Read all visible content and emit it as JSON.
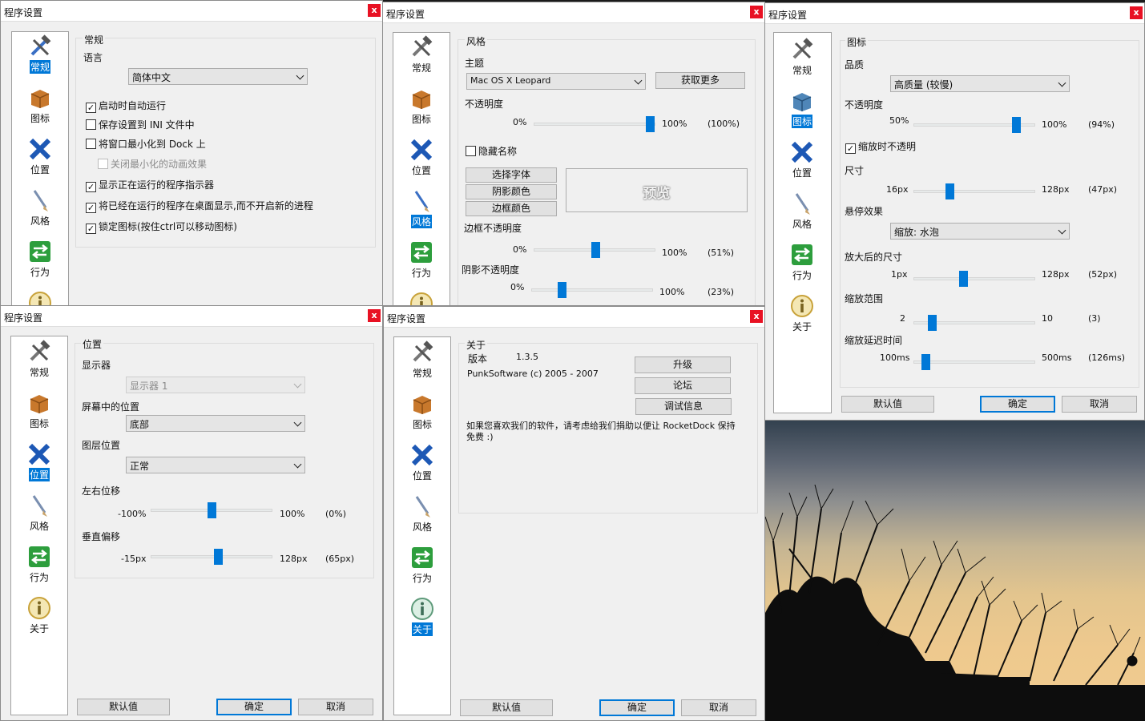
{
  "window_title": "程序设置",
  "close_glyph": "x",
  "nav": {
    "general": "常规",
    "icons": "图标",
    "position": "位置",
    "style": "风格",
    "behavior": "行为",
    "about": "关于"
  },
  "buttons": {
    "defaults": "默认值",
    "ok": "确定",
    "cancel": "取消"
  },
  "general": {
    "title": "常规",
    "language_label": "语言",
    "language_value": "简体中文",
    "options": [
      {
        "label": "启动时自动运行",
        "checked": true,
        "enabled": true
      },
      {
        "label": "保存设置到 INI 文件中",
        "checked": false,
        "enabled": true
      },
      {
        "label": "将窗口最小化到 Dock 上",
        "checked": false,
        "enabled": true
      },
      {
        "label": "关闭最小化的动画效果",
        "checked": false,
        "enabled": false
      },
      {
        "label": "显示正在运行的程序指示器",
        "checked": true,
        "enabled": true
      },
      {
        "label": "将已经在运行的程序在桌面显示,而不开启新的进程",
        "checked": true,
        "enabled": true
      },
      {
        "label": "锁定图标(按住ctrl可以移动图标)",
        "checked": true,
        "enabled": true
      }
    ]
  },
  "style": {
    "title": "风格",
    "theme_label": "主题",
    "theme_value": "Mac OS X Leopard",
    "get_more": "获取更多",
    "opacity": {
      "label": "不透明度",
      "min": "0%",
      "max": "100%",
      "value": "(100%)",
      "level": 1.0
    },
    "hide_labels": {
      "label": "隐藏名称",
      "checked": false
    },
    "font_button": "选择字体",
    "shadow_button": "阴影颜色",
    "border_button": "边框颜色",
    "preview": "预览",
    "border_opacity": {
      "label": "边框不透明度",
      "min": "0%",
      "max": "100%",
      "value": "(51%)",
      "level": 0.51
    },
    "shadow_opacity": {
      "label": "阴影不透明度",
      "min": "0%",
      "max": "100%",
      "value": "(23%)",
      "level": 0.23
    }
  },
  "icons": {
    "title": "图标",
    "quality_label": "品质",
    "quality_value": "高质量 (较慢)",
    "opacity": {
      "label": "不透明度",
      "min": "50%",
      "max": "100%",
      "value": "(94%)",
      "level": 0.88
    },
    "zoom_opaque": {
      "label": "缩放时不透明",
      "checked": true
    },
    "size": {
      "label": "尺寸",
      "min": "16px",
      "max": "128px",
      "value": "(47px)",
      "level": 0.28
    },
    "hover_label": "悬停效果",
    "hover_value": "缩放: 水泡",
    "zoom_size": {
      "label": "放大后的尺寸",
      "min": "1px",
      "max": "128px",
      "value": "(52px)",
      "level": 0.4
    },
    "zoom_range": {
      "label": "缩放范围",
      "min": "2",
      "max": "10",
      "value": "(3)",
      "level": 0.125
    },
    "zoom_delay": {
      "label": "缩放延迟时间",
      "min": "100ms",
      "max": "500ms",
      "value": "(126ms)",
      "level": 0.065
    }
  },
  "position": {
    "title": "位置",
    "monitor_label": "显示器",
    "monitor_value": "显示器 1",
    "screen_pos_label": "屏幕中的位置",
    "screen_pos_value": "底部",
    "layer_label": "图层位置",
    "layer_value": "正常",
    "h_offset": {
      "label": "左右位移",
      "min": "-100%",
      "max": "100%",
      "value": "(0%)",
      "level": 0.5
    },
    "v_offset": {
      "label": "垂直偏移",
      "min": "-15px",
      "max": "128px",
      "value": "(65px)",
      "level": 0.56
    }
  },
  "about": {
    "title": "关于",
    "version_label": "版本",
    "version_value": "1.3.5",
    "copyright": "PunkSoftware (c) 2005 - 2007",
    "upgrade": "升级",
    "forum": "论坛",
    "debug": "调试信息",
    "donate": "如果您喜欢我们的软件，请考虑给我们捐助以便让 RocketDock 保持免费 :)"
  },
  "colors": {
    "accent": "#0078d7",
    "close": "#e81123",
    "window_bg": "#f0f0f0"
  }
}
